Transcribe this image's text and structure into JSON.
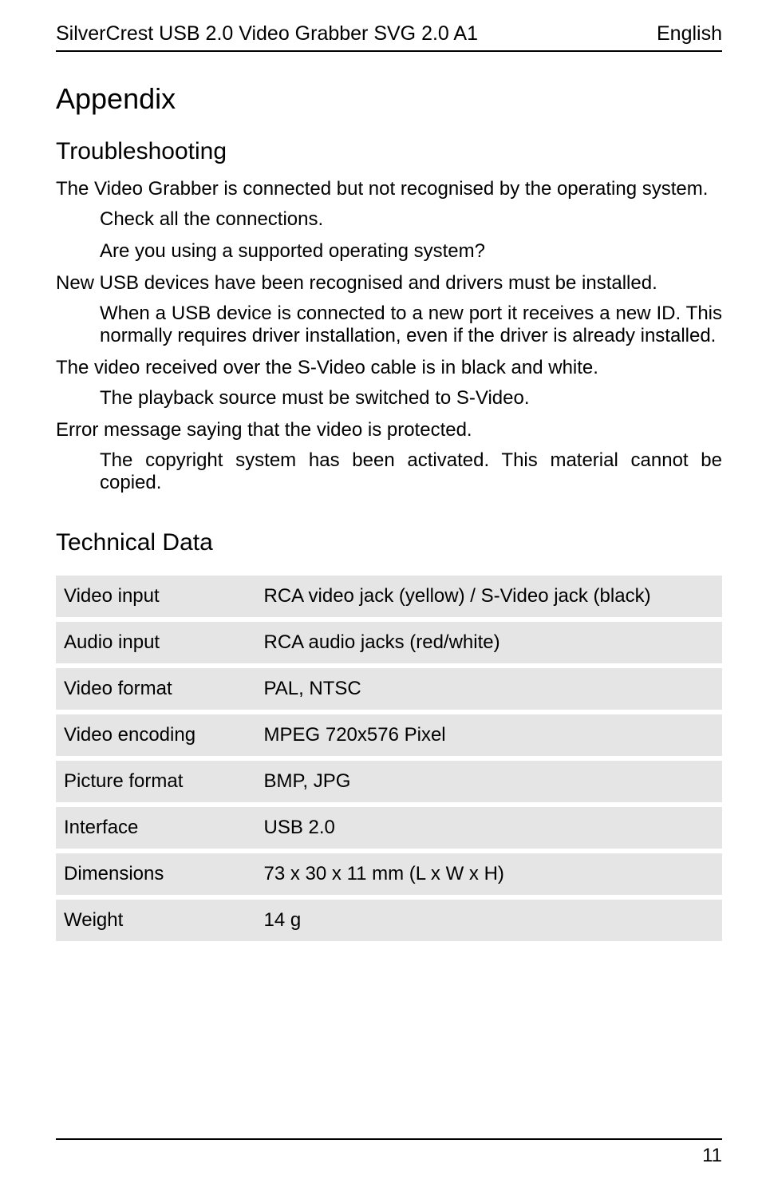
{
  "header": {
    "left": "SilverCrest USB 2.0 Video Grabber SVG 2.0 A1",
    "right": "English"
  },
  "h1": "Appendix",
  "h2_troubleshooting": "Troubleshooting",
  "troubleshooting": [
    {
      "issue": "The Video Grabber is connected but not recognised by the operating system.",
      "answers": [
        "Check all the connections.",
        "Are you using a supported operating system?"
      ]
    },
    {
      "issue": "New USB devices have been recognised and drivers must be installed.",
      "answers": [
        "When a USB device is connected to a new port it receives a new ID. This normally requires driver installation, even if the driver is already installed."
      ],
      "justify": true
    },
    {
      "issue": "The video received over the S-Video cable is in black and white.",
      "answers": [
        "The playback source must be switched to S-Video."
      ]
    },
    {
      "issue": "Error message saying that the video is protected.",
      "answers": [
        "The copyright system has been activated. This material cannot be copied."
      ],
      "justify": true
    }
  ],
  "h2_tech": "Technical Data",
  "specs": [
    [
      "Video input",
      "RCA video jack (yellow) / S-Video jack (black)"
    ],
    [
      "Audio input",
      "RCA audio jacks (red/white)"
    ],
    [
      "Video format",
      "PAL, NTSC"
    ],
    [
      "Video encoding",
      "MPEG 720x576 Pixel"
    ],
    [
      "Picture format",
      "BMP, JPG"
    ],
    [
      "Interface",
      "USB 2.0"
    ],
    [
      "Dimensions",
      "73 x 30 x 11 mm (L x W x H)"
    ],
    [
      "Weight",
      "14 g"
    ]
  ],
  "page_number": "11"
}
